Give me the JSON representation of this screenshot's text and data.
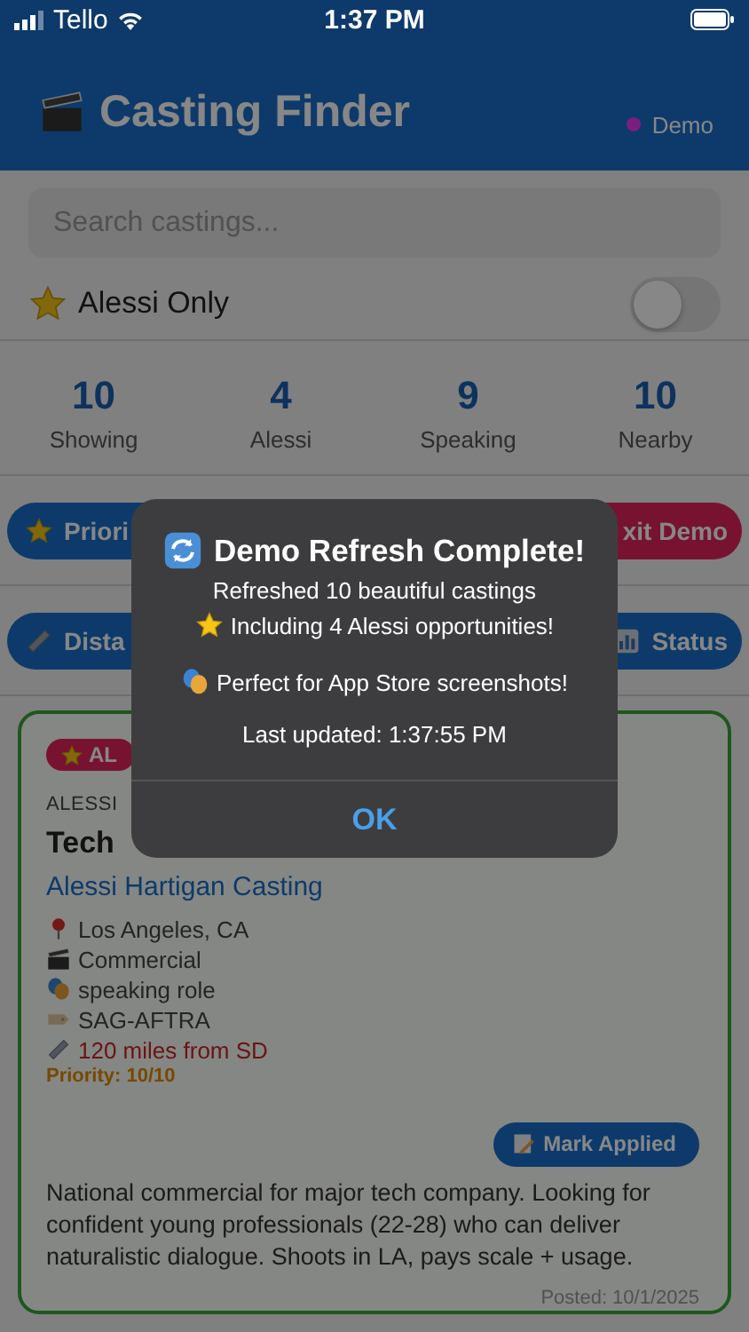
{
  "status_bar": {
    "carrier": "Tello",
    "time": "1:37 PM"
  },
  "header": {
    "title": "Casting Finder",
    "mode": {
      "label": "Demo",
      "color": "#7a1f80"
    }
  },
  "search": {
    "placeholder": "Search castings..."
  },
  "filter_toggle": {
    "label": "Alessi Only",
    "on": false
  },
  "stats": [
    {
      "value": "10",
      "label": "Showing"
    },
    {
      "value": "4",
      "label": "Alessi"
    },
    {
      "value": "9",
      "label": "Speaking"
    },
    {
      "value": "10",
      "label": "Nearby"
    }
  ],
  "action_rows": [
    [
      {
        "label": "Priori",
        "kind": "priority"
      },
      {
        "label": "xit Demo",
        "kind": "exit"
      }
    ],
    [
      {
        "label": "Dista",
        "kind": "distance"
      },
      {
        "label": "Status",
        "kind": "status"
      }
    ]
  ],
  "card": {
    "badge": "AL",
    "kicker": "ALESSI",
    "title": "Tech",
    "company": "Alessi Hartigan Casting",
    "details": [
      {
        "kind": "pin",
        "text": "Los Angeles, CA"
      },
      {
        "kind": "clapper",
        "text": "Commercial"
      },
      {
        "kind": "masks",
        "text": "speaking role"
      },
      {
        "kind": "tag",
        "text": "SAG-AFTRA"
      },
      {
        "kind": "distance",
        "text": "120 miles from SD"
      }
    ],
    "priority": "Priority: 10/10",
    "button": "Mark Applied",
    "description": "National commercial for major tech company. Looking for confident young professionals (22-28) who can deliver naturalistic dialogue. Shoots in LA, pays scale + usage.",
    "posted": "Posted: 10/1/2025"
  },
  "alert": {
    "title": "Demo Refresh Complete!",
    "lines": [
      "Refreshed 10 beautiful castings",
      "Including 4 Alessi opportunities!"
    ],
    "note": "Perfect for App Store screenshots!",
    "timestamp": "Last updated: 1:37:55 PM",
    "button": "OK"
  }
}
